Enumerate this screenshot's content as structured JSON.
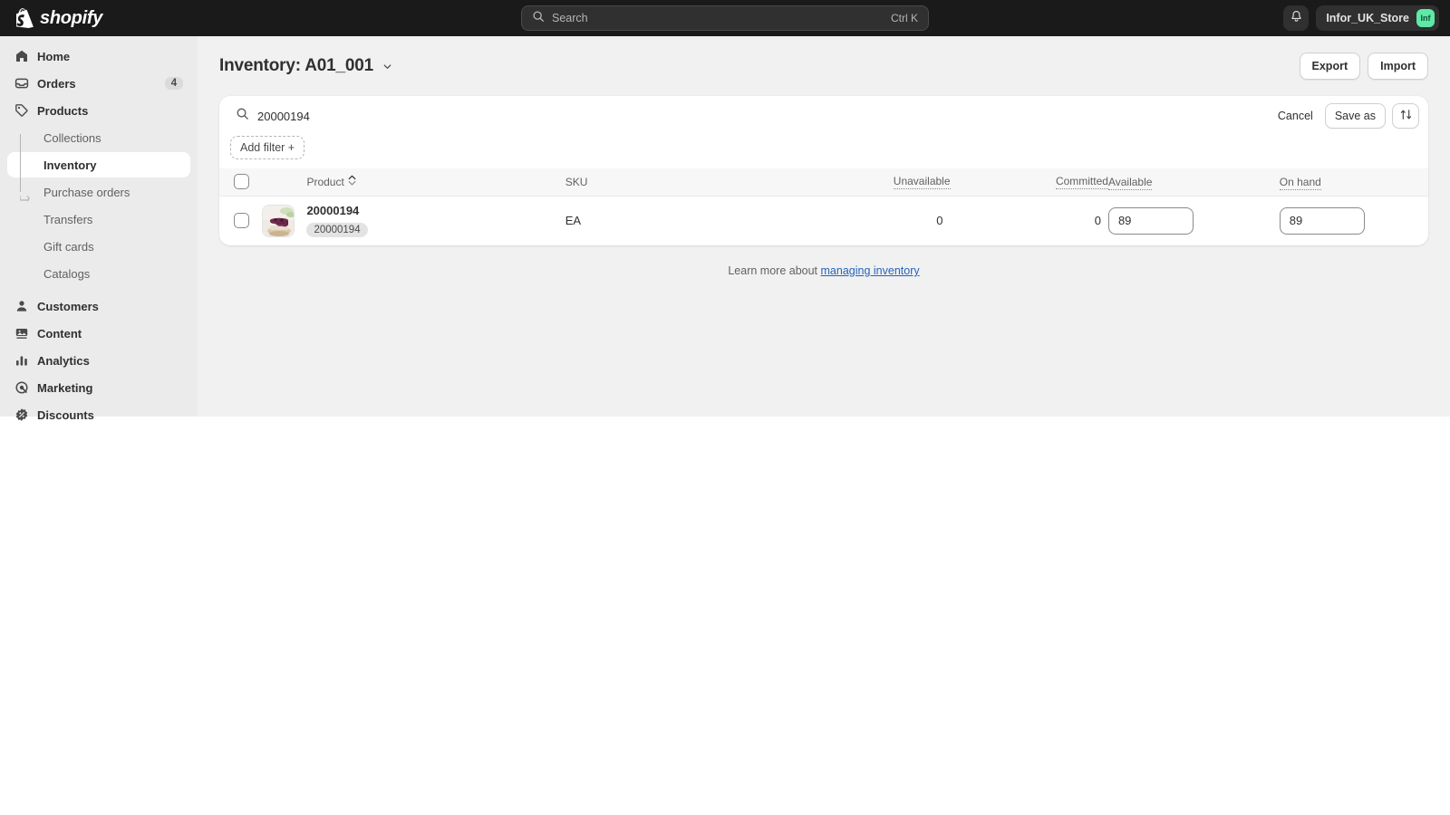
{
  "topbar": {
    "brand": "shopify",
    "brand_icon": "shopify-bag-icon",
    "search": {
      "icon": "search-icon",
      "placeholder": "Search",
      "shortcut": "Ctrl K"
    },
    "notifications_icon": "bell-icon",
    "store_name": "Infor_UK_Store",
    "store_initials": "Inf",
    "avatar_color": "#5ee9a8"
  },
  "sidebar": {
    "items": [
      {
        "label": "Home",
        "icon": "home-icon",
        "badge": null
      },
      {
        "label": "Orders",
        "icon": "orders-inbox-icon",
        "badge": "4"
      },
      {
        "label": "Products",
        "icon": "products-tag-icon",
        "badge": null
      }
    ],
    "sub_items": [
      {
        "label": "Collections",
        "active": false
      },
      {
        "label": "Inventory",
        "active": true
      },
      {
        "label": "Purchase orders",
        "active": false
      },
      {
        "label": "Transfers",
        "active": false
      },
      {
        "label": "Gift cards",
        "active": false
      },
      {
        "label": "Catalogs",
        "active": false
      }
    ],
    "items_lower": [
      {
        "label": "Customers",
        "icon": "customers-person-icon"
      },
      {
        "label": "Content",
        "icon": "content-image-icon"
      },
      {
        "label": "Analytics",
        "icon": "analytics-bars-icon"
      },
      {
        "label": "Marketing",
        "icon": "marketing-target-icon"
      },
      {
        "label": "Discounts",
        "icon": "discounts-badge-icon"
      }
    ]
  },
  "page": {
    "title": "Inventory: A01_001",
    "title_caret_icon": "chevron-down-icon",
    "export_label": "Export",
    "import_label": "Import"
  },
  "filters": {
    "search_icon": "search-icon",
    "search_value": "20000194",
    "search_placeholder": "Search inventory",
    "cancel_label": "Cancel",
    "save_as_label": "Save as",
    "sort_icon": "sort-arrows-icon",
    "add_filter_label": "Add filter +"
  },
  "table": {
    "select_all_icon": "checkbox-icon",
    "columns": {
      "product": "Product",
      "product_sort_icon": "sort-chevrons-icon",
      "sku": "SKU",
      "unavailable": "Unavailable",
      "committed": "Committed",
      "available": "Available",
      "on_hand": "On hand"
    },
    "rows": [
      {
        "thumbnail_icon": "product-thumbnail-dessert",
        "product": "20000194",
        "product_badge": "20000194",
        "sku": "EA",
        "unavailable": "0",
        "committed": "0",
        "available": "89",
        "on_hand": "89"
      }
    ]
  },
  "footer": {
    "text": "Learn more about ",
    "link": "managing inventory"
  }
}
